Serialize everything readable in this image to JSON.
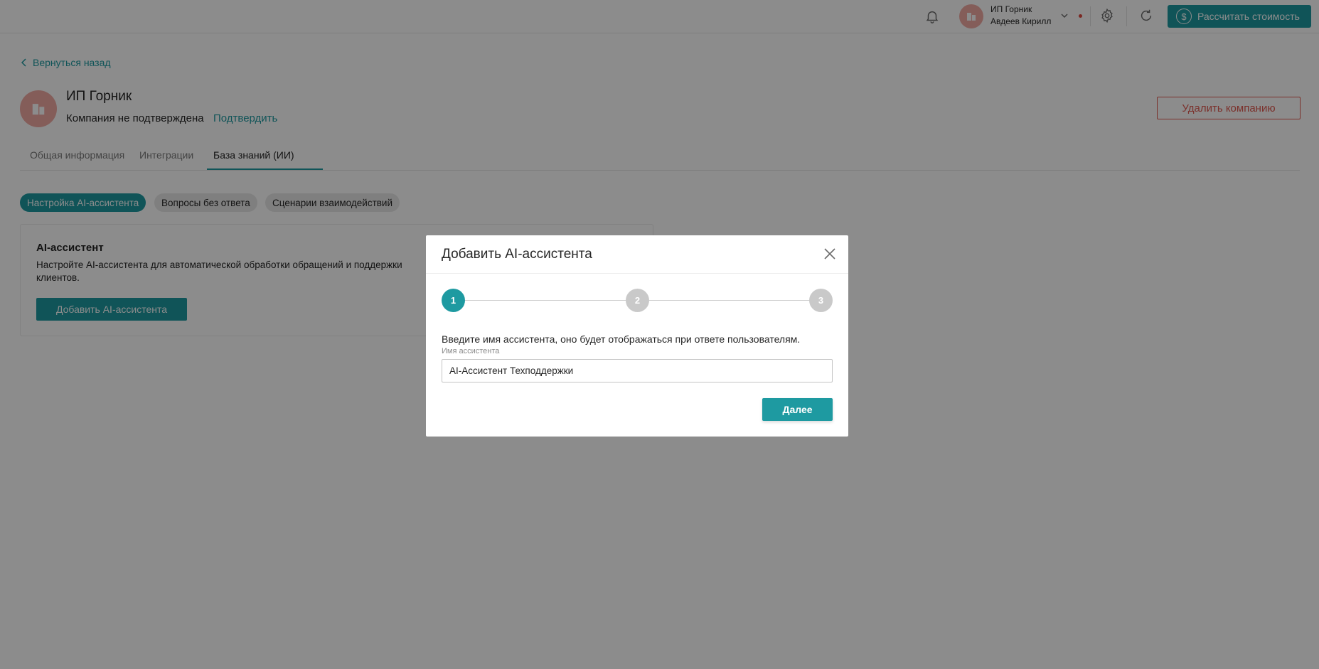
{
  "topbar": {
    "company": "ИП Горник",
    "user": "Авдеев Кирилл",
    "calc_label": "Рассчитать стоимость",
    "icons": [
      "bell-icon",
      "building-icon",
      "chevron-down-icon",
      "gear-icon",
      "refresh-icon",
      "dollar-coin-icon"
    ]
  },
  "page": {
    "back_label": "Вернуться назад",
    "company_name": "ИП Горник",
    "status": "Компания не подтверждена",
    "confirm_label": "Подтвердить",
    "delete_label": "Удалить компанию",
    "tabs": [
      "Общая информация",
      "Интеграции",
      "База знаний (ИИ)"
    ],
    "chips": [
      "Настройка AI-ассистента",
      "Вопросы без ответа",
      "Сценарии взаимодействий"
    ],
    "card": {
      "title": "AI-ассистент",
      "description": "Настройте AI-ассистента для автоматической обработки обращений и поддержки клиентов.",
      "button": "Добавить AI-ассистента"
    }
  },
  "modal": {
    "title": "Добавить AI-ассистента",
    "steps": [
      "1",
      "2",
      "3"
    ],
    "active_step": 1,
    "instruction": "Введите имя ассистента, оно будет отображаться при ответе пользователям.",
    "field_label": "Имя ассистента",
    "field_value": "AI-Ассистент Техподдержки",
    "next_label": "Далее"
  },
  "colors": {
    "accent": "#1e9aa1",
    "danger": "#e15a50",
    "avatar": "#f0a9a3"
  }
}
